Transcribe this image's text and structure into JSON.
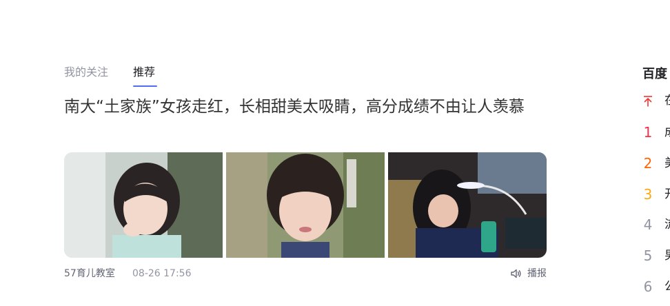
{
  "tabs": {
    "follow": "我的关注",
    "recommend": "推荐"
  },
  "article": {
    "title": "南大“土家族”女孩走红，长相甜美太吸睛，高分成绩不由让人羡慕",
    "source": "57育儿教室",
    "time": "08-26 17:56",
    "broadcast": "播报"
  },
  "hot": {
    "title": "百度",
    "items": [
      {
        "rank": "",
        "text": "在"
      },
      {
        "rank": "1",
        "text": "成"
      },
      {
        "rank": "2",
        "text": "美"
      },
      {
        "rank": "3",
        "text": "开"
      },
      {
        "rank": "4",
        "text": "流"
      },
      {
        "rank": "5",
        "text": "男"
      },
      {
        "rank": "6",
        "text": "公"
      }
    ]
  },
  "colors": {
    "accent": "#4e6ef2",
    "rank_top": "#f73131",
    "rank_1": "#fe2d46",
    "rank_2": "#ff6600",
    "rank_3": "#faa90e",
    "rank_other": "#9195a3"
  }
}
